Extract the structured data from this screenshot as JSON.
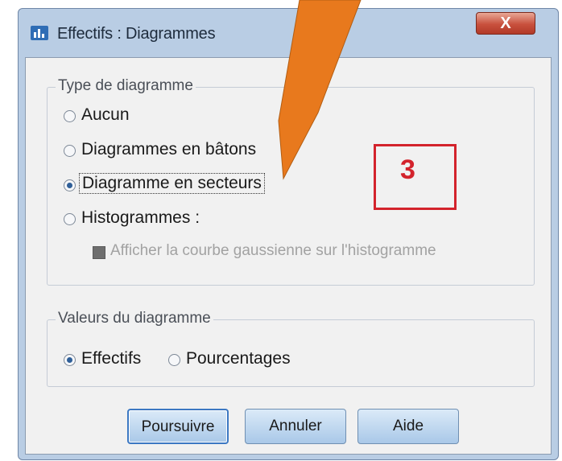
{
  "window": {
    "title": "Effectifs : Diagrammes",
    "close_label": "X"
  },
  "chart_type_group": {
    "label": "Type de diagramme",
    "options": [
      {
        "label": "Aucun",
        "selected": false
      },
      {
        "label": "Diagrammes en bâtons",
        "selected": false
      },
      {
        "label": "Diagramme en secteurs",
        "selected": true
      },
      {
        "label": "Histogrammes :",
        "selected": false
      }
    ],
    "normal_curve_checkbox": {
      "label": "Afficher la courbe gaussienne sur l'histogramme",
      "enabled": false
    }
  },
  "chart_values_group": {
    "label": "Valeurs du diagramme",
    "options": [
      {
        "label": "Effectifs",
        "selected": true
      },
      {
        "label": "Pourcentages",
        "selected": false
      }
    ]
  },
  "buttons": {
    "continue": "Poursuivre",
    "cancel": "Annuler",
    "help": "Aide"
  },
  "annotation": {
    "step_number": "3",
    "color": "#d3232c",
    "arrow_color": "#e8791d"
  }
}
